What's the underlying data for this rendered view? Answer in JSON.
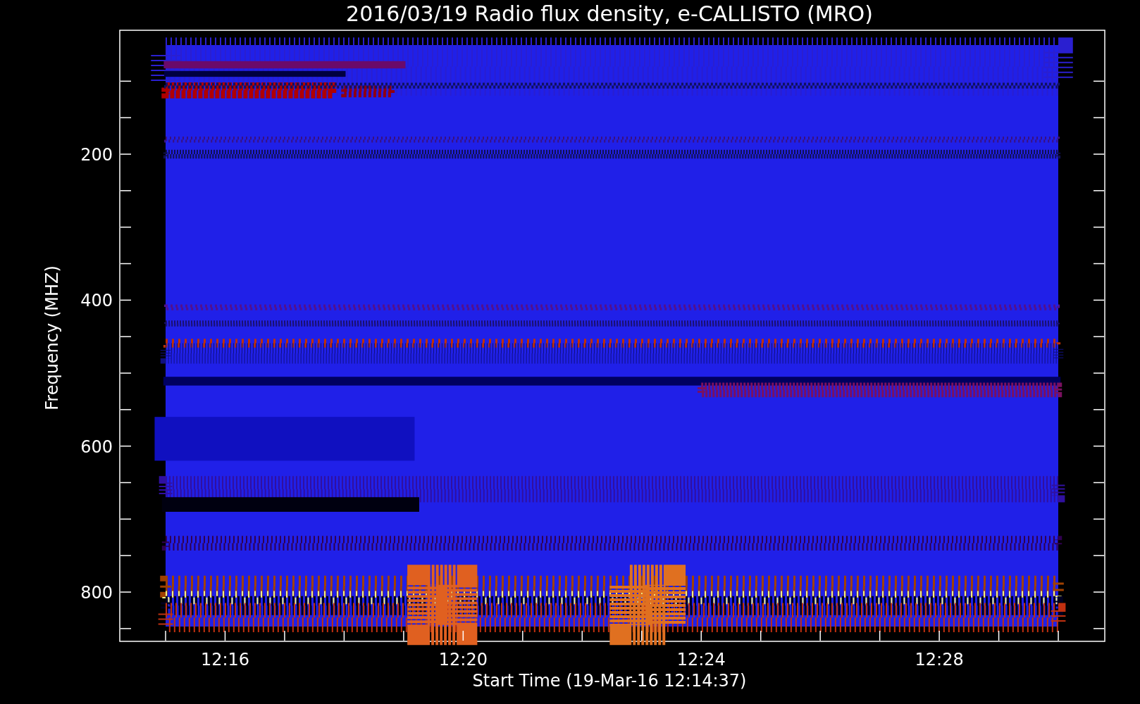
{
  "title": "2016/03/19  Radio flux density, e-CALLISTO (MRO)",
  "y_axis": {
    "label": "Frequency (MHZ)",
    "ticks": [
      "200",
      "400",
      "600",
      "800"
    ]
  },
  "x_axis": {
    "label": "Start Time (19-Mar-16 12:14:37)",
    "ticks": [
      "12:16",
      "12:20",
      "12:24",
      "12:28"
    ]
  }
}
